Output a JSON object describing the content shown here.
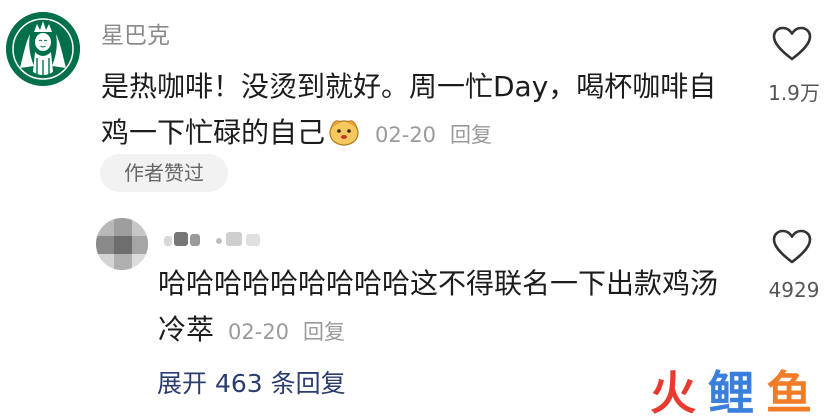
{
  "comment": {
    "username": "星巴克",
    "text": "是热咖啡！没烫到就好。周一忙Day，喝杯咖啡自鸡一下忙碌的自己",
    "date": "02-20",
    "reply_label": "回复",
    "author_badge": "作者赞过",
    "likes": "1.9万"
  },
  "reply": {
    "text": "哈哈哈哈哈哈哈哈哈这不得联名一下出款鸡汤冷萃",
    "date": "02-20",
    "reply_label": "回复",
    "likes": "4929"
  },
  "expand_replies": "展开 463 条回复",
  "watermark": {
    "chars": [
      "火",
      "鲤",
      "鱼"
    ],
    "colors": [
      "#e83a2e",
      "#3b7fdc",
      "#f07c28"
    ]
  },
  "colors": {
    "brand": "#00704a",
    "link": "#2b3c6e",
    "meta": "#9a9a9a"
  },
  "icons": [
    "starbucks-logo-avatar",
    "heart-outline-icon",
    "dog-emoji-icon",
    "blurred-avatar"
  ]
}
